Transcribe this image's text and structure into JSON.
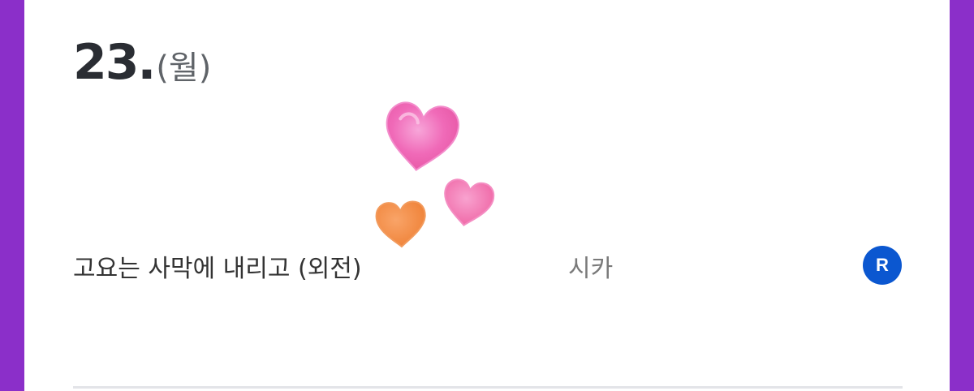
{
  "date": {
    "number": "23.",
    "weekday": "(월)"
  },
  "entry": {
    "title": "고요는 사막에 내리고 (외전)",
    "author": "시카",
    "badge": "R",
    "badge_color": "#0b57d0"
  },
  "stickers": [
    "heart-icon",
    "heart-icon",
    "heart-icon"
  ],
  "colors": {
    "frame": "#8b2fc9",
    "heart_pink": "#f06ab8",
    "heart_orange": "#f5904a"
  }
}
